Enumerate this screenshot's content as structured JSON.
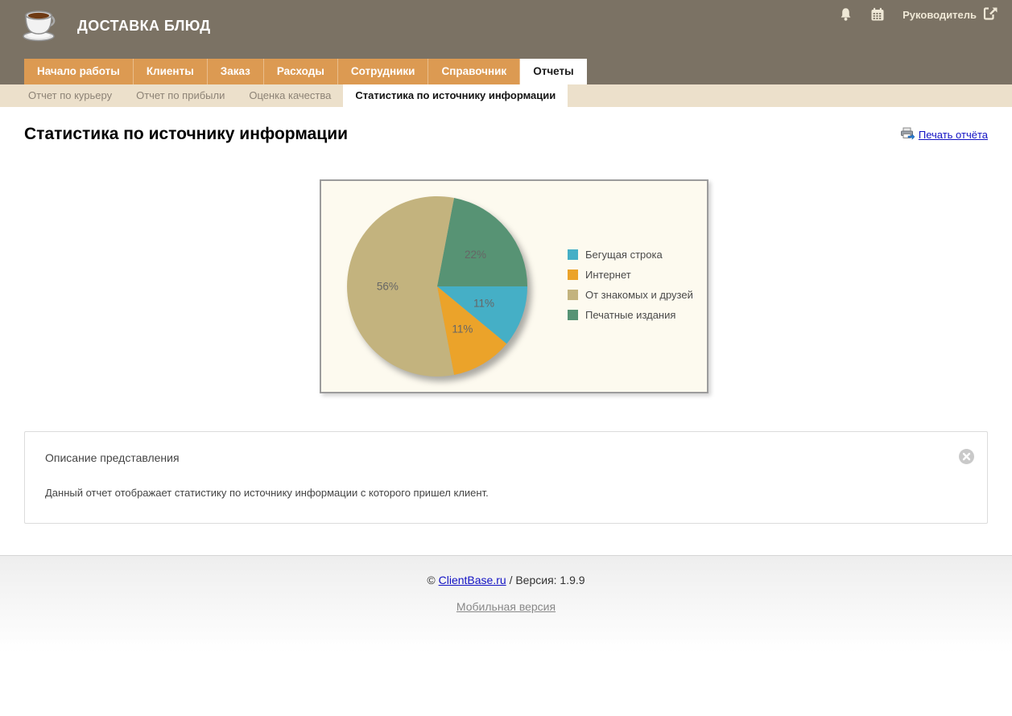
{
  "header": {
    "app_title": "ДОСТАВКА БЛЮД",
    "user_role": "Руководитель",
    "icons": [
      "coffee-cup-logo",
      "bell-icon",
      "calendar-icon",
      "logout-icon"
    ]
  },
  "nav": {
    "tabs": [
      {
        "label": "Начало работы",
        "active": false
      },
      {
        "label": "Клиенты",
        "active": false
      },
      {
        "label": "Заказ",
        "active": false
      },
      {
        "label": "Расходы",
        "active": false
      },
      {
        "label": "Сотрудники",
        "active": false
      },
      {
        "label": "Справочник",
        "active": false
      },
      {
        "label": "Отчеты",
        "active": true
      }
    ],
    "subtabs": [
      {
        "label": "Отчет по курьеру",
        "active": false
      },
      {
        "label": "Отчет по прибыли",
        "active": false
      },
      {
        "label": "Оценка качества",
        "active": false
      },
      {
        "label": "Статистика по источнику информации",
        "active": true
      }
    ]
  },
  "page": {
    "title": "Статистика по источнику информации",
    "print_link": "Печать отчёта",
    "print_icon": "printer-icon"
  },
  "chart_data": {
    "type": "pie",
    "start_angle_deg": 10.8,
    "clockwise": true,
    "background": "#fdfaef",
    "label_color": "#666666",
    "slices": [
      {
        "label": "Печатные издания",
        "value_pct": 22,
        "display": "22%",
        "color": "#579374"
      },
      {
        "label": "Бегущая строка",
        "value_pct": 11,
        "display": "11%",
        "color": "#45afc6"
      },
      {
        "label": "Интернет",
        "value_pct": 11,
        "display": "11%",
        "color": "#eba32a"
      },
      {
        "label": "От знакомых и друзей",
        "value_pct": 56,
        "display": "56%",
        "color": "#c3b37e"
      }
    ],
    "legend": [
      "Бегущая строка",
      "Интернет",
      "От знакомых и друзей",
      "Печатные издания"
    ],
    "legend_position": "right"
  },
  "description": {
    "title": "Описание представления",
    "text": "Данный отчет отображает статистику по источнику информации с которого пришел клиент.",
    "close_icon": "close-icon"
  },
  "footer": {
    "copyright": "©",
    "site_link": "ClientBase.ru",
    "version": "/ Версия: 1.9.9",
    "mobile_link": "Мобильная версия"
  }
}
